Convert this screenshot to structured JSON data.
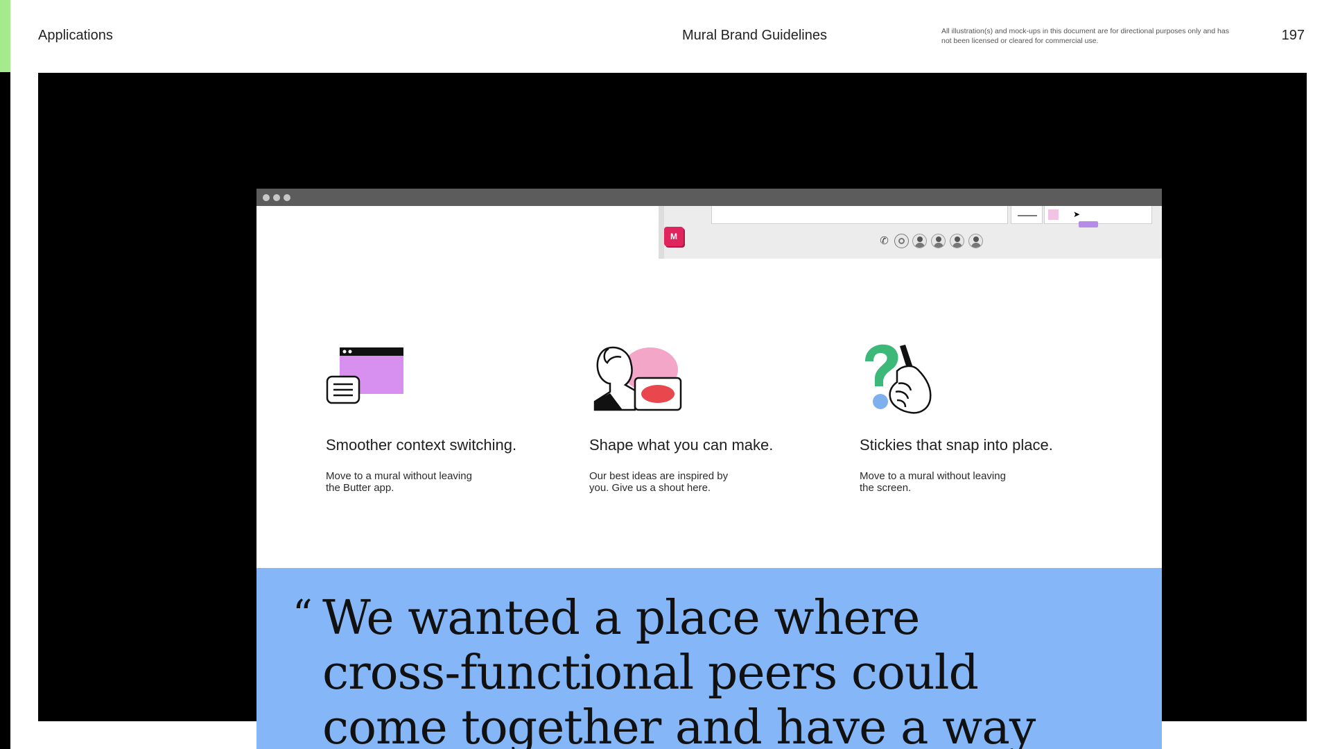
{
  "header": {
    "section": "Applications",
    "title": "Mural Brand Guidelines",
    "disclaimer": "All illustration(s) and mock-ups in this document are for directional purposes only and has not been licensed or cleared for commercial use.",
    "page_number": "197"
  },
  "colors": {
    "accent_green": "#a6ea8e",
    "quote_blue": "#85b7f8",
    "mural_pink": "#e0245e"
  },
  "window": {
    "controls": [
      "close-dot",
      "minimize-dot",
      "maximize-dot"
    ],
    "logo_letter": "M",
    "features": [
      {
        "icon": "browser-window-icon",
        "title": "Smoother context switching.",
        "description": "Move to a mural without leaving the Butter app."
      },
      {
        "icon": "person-idea-icon",
        "title": "Shape what you can make.",
        "description": "Our best ideas are inspired by you. Give us a shout here."
      },
      {
        "icon": "question-hand-icon",
        "title": "Stickies that snap into place.",
        "description": "Move to a mural without leaving the screen."
      }
    ],
    "quote": {
      "open_mark": "“",
      "lines": "We wanted a place where\ncross-functional peers could\ncome together and have a way"
    }
  }
}
